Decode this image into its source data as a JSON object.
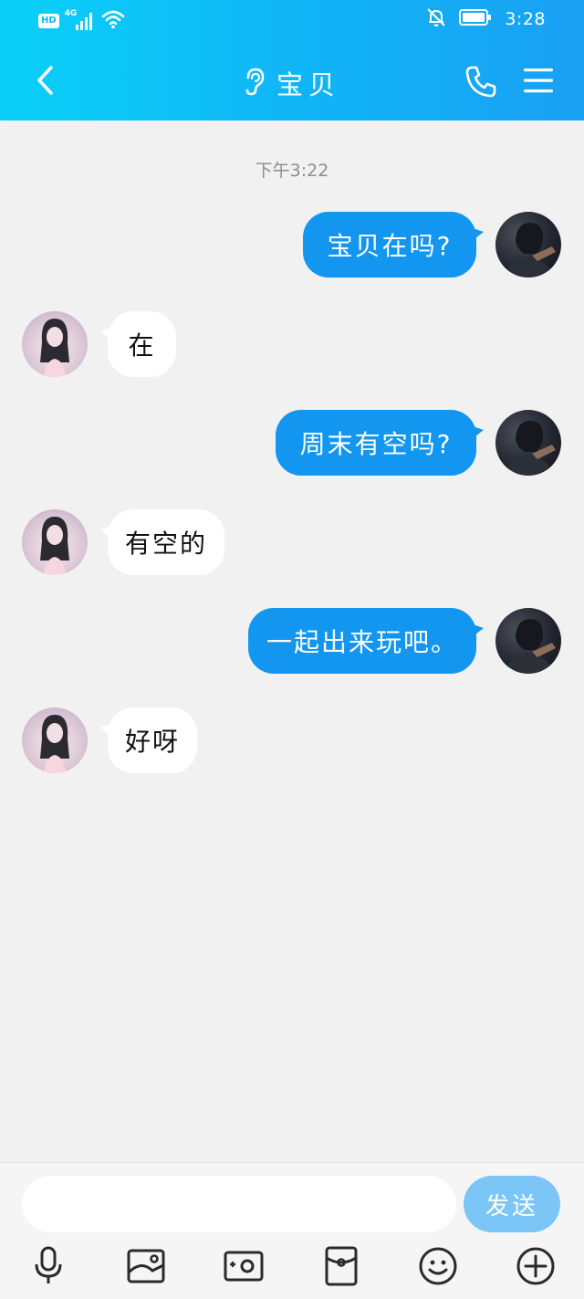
{
  "status_bar": {
    "hd_label": "HD",
    "network_label": "4G",
    "time": "3:28"
  },
  "header": {
    "title": "宝贝"
  },
  "chat": {
    "timestamp": "下午3:22",
    "messages": [
      {
        "sender": "me",
        "text": "宝贝在吗?"
      },
      {
        "sender": "contact",
        "text": "在"
      },
      {
        "sender": "me",
        "text": "周末有空吗?"
      },
      {
        "sender": "contact",
        "text": "有空的"
      },
      {
        "sender": "me",
        "text": "一起出来玩吧。"
      },
      {
        "sender": "contact",
        "text": "好呀"
      }
    ]
  },
  "composer": {
    "input_value": "",
    "send_label": "发送"
  },
  "colors": {
    "header_gradient_start": "#0ad0f7",
    "header_gradient_end": "#1aa0f3",
    "outgoing_bubble": "#1296f0",
    "incoming_bubble": "#ffffff",
    "send_button": "#7cc5f7",
    "chat_background": "#f1f1f1"
  },
  "icons": {
    "back": "chevron-left-icon",
    "ear_mode": "ear-icon",
    "call": "phone-icon",
    "menu": "menu-icon",
    "voice": "microphone-icon",
    "photo": "image-icon",
    "camera": "camera-icon",
    "red_packet": "red-packet-icon",
    "emoji": "emoji-icon",
    "more": "plus-circle-icon"
  }
}
